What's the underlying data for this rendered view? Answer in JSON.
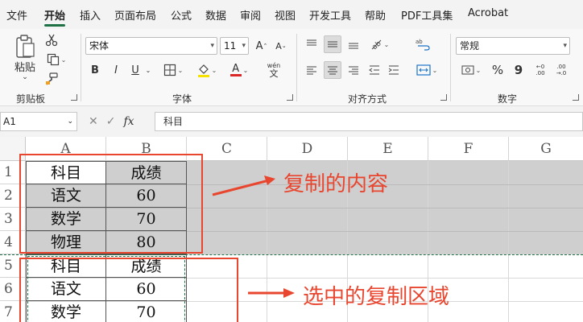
{
  "menu": {
    "tabs": [
      "文件",
      "开始",
      "插入",
      "页面布局",
      "公式",
      "数据",
      "审阅",
      "视图",
      "开发工具",
      "帮助",
      "PDF工具集",
      "Acrobat"
    ],
    "active_tab": "开始"
  },
  "ribbon": {
    "clipboard": {
      "paste_label": "粘贴",
      "group_label": "剪贴板"
    },
    "font": {
      "family": "宋体",
      "size": "11",
      "grow": "A",
      "shrink": "A",
      "bold": "B",
      "italic": "I",
      "underline": "U",
      "font_color_glyph": "A",
      "highlight_color": "#f5e200",
      "font_color": "#d92626",
      "wen": "wén",
      "wen_char": "文",
      "group_label": "字体"
    },
    "alignment": {
      "group_label": "对齐方式"
    },
    "number": {
      "format": "常规",
      "percent": "%",
      "comma": "9",
      "group_label": "数字"
    }
  },
  "formula_bar": {
    "name_box": "A1",
    "fx": "fx",
    "content": "科目"
  },
  "grid": {
    "columns": [
      "A",
      "B",
      "C",
      "D",
      "E",
      "F",
      "G"
    ],
    "rows": [
      "1",
      "2",
      "3",
      "4",
      "5",
      "6",
      "7"
    ],
    "cells": [
      [
        "科目",
        "成绩"
      ],
      [
        "语文",
        "60"
      ],
      [
        "数学",
        "70"
      ],
      [
        "物理",
        "80"
      ],
      [
        "科目",
        "成绩"
      ],
      [
        "语文",
        "60"
      ],
      [
        "数学",
        "70"
      ]
    ]
  },
  "annotations": {
    "copied": "复制的内容",
    "pasted": "选中的复制区域",
    "color": "#e8462f"
  }
}
